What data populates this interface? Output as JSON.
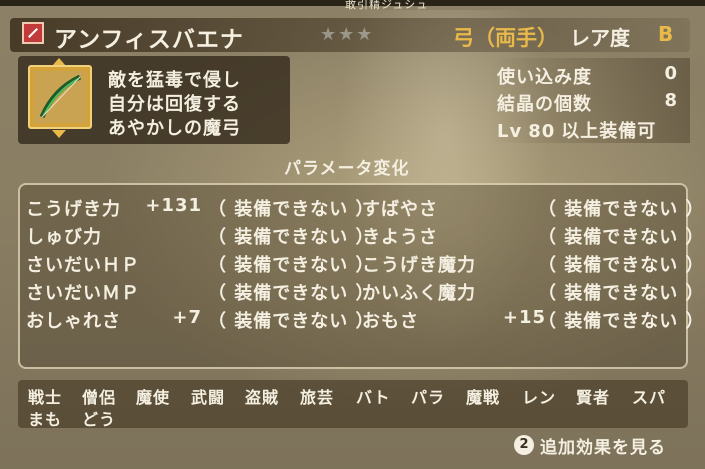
{
  "header": {
    "top_caption": "敢引精ジュシュ",
    "item_name": "アンフィスバエナ",
    "stars": "★★★",
    "category": "弓（両手）",
    "rarity_label": "レア度",
    "rarity_value": "B"
  },
  "description": {
    "lines": [
      "敵を猛毒で侵し",
      "自分は回復する",
      "あやかしの魔弓"
    ]
  },
  "info": {
    "usage_label": "使い込み度",
    "usage_value": "0",
    "crystal_label": "結晶の個数",
    "crystal_value": "8",
    "lv_tag": "Lv",
    "lv_value": "80",
    "lv_suffix": "以上装備可"
  },
  "params": {
    "title": "パラメータ変化",
    "left": [
      {
        "name": "こうげき力",
        "value": "+131",
        "status": "（ 装備できない ）"
      },
      {
        "name": "しゅび力",
        "value": "",
        "status": "（ 装備できない ）"
      },
      {
        "name": "さいだいＨＰ",
        "value": "",
        "status": "（ 装備できない ）"
      },
      {
        "name": "さいだいＭＰ",
        "value": "",
        "status": "（ 装備できない ）"
      },
      {
        "name": "おしゃれさ",
        "value": "+7",
        "status": "（ 装備できない ）"
      }
    ],
    "right": [
      {
        "name": "すばやさ",
        "value": "",
        "status": "（ 装備できない ）"
      },
      {
        "name": "きようさ",
        "value": "",
        "status": "（ 装備できない ）"
      },
      {
        "name": "こうげき魔力",
        "value": "",
        "status": "（ 装備できない ）"
      },
      {
        "name": "かいふく魔力",
        "value": "",
        "status": "（ 装備できない ）"
      },
      {
        "name": "おもさ",
        "value": "+15",
        "status": "（ 装備できない ）"
      }
    ]
  },
  "jobs": {
    "row1": [
      "戦士",
      "僧侶",
      "魔使",
      "武闘",
      "盗賊",
      "旅芸",
      "バト",
      "パラ",
      "魔戦",
      "レン",
      "賢者",
      "スパ"
    ],
    "row2": [
      "まも",
      "どう"
    ]
  },
  "footer": {
    "button_number": "2",
    "button_label": "追加効果を見る"
  }
}
